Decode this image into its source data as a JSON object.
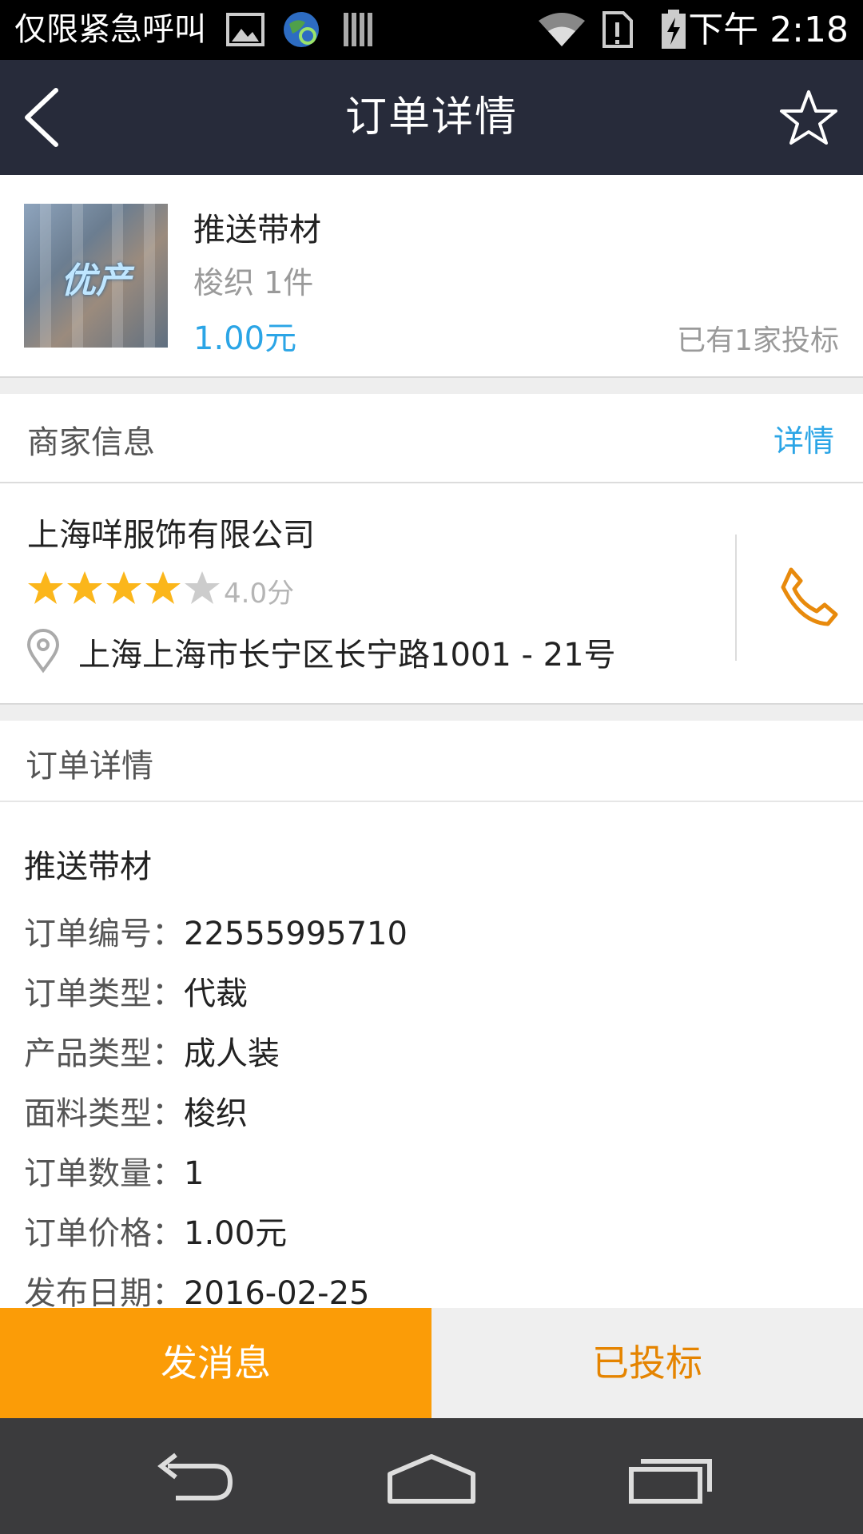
{
  "status_bar": {
    "carrier_text": "仅限紧急呼叫",
    "time": "下午 2:18",
    "icons": [
      "image-icon",
      "globe-sync-icon",
      "barcode-icon",
      "wifi-icon",
      "sim-alert-icon",
      "battery-charging-icon"
    ]
  },
  "header": {
    "title": "订单详情",
    "back_icon": "chevron-left-icon",
    "favorite_icon": "star-outline-icon"
  },
  "product": {
    "thumbnail_text": "优产",
    "name": "推送带材",
    "subtitle": "梭织 1件",
    "price": "1.00元",
    "bids": "已有1家投标"
  },
  "merchant_section": {
    "label": "商家信息",
    "detail_link": "详情"
  },
  "merchant": {
    "name": "上海咩服饰有限公司",
    "stars_filled": 4,
    "stars_total": 5,
    "rating": "4.0分",
    "address": "上海上海市长宁区长宁路1001 - 21号",
    "colors": {
      "star": "#fbb61b",
      "star_empty": "#cccccc",
      "phone": "#e88a0c"
    }
  },
  "order_section": {
    "label": "订单详情",
    "title": "推送带材",
    "rows": [
      {
        "key": "订单编号：",
        "value": "22555995710"
      },
      {
        "key": "订单类型：",
        "value": "代裁"
      },
      {
        "key": "产品类型：",
        "value": "成人装"
      },
      {
        "key": "面料类型：",
        "value": "梭织"
      },
      {
        "key": "订单数量：",
        "value": "1"
      },
      {
        "key": "订单价格：",
        "value": "1.00元"
      },
      {
        "key": "发布日期：",
        "value": "2016-02-25"
      }
    ]
  },
  "actions": {
    "message": "发消息",
    "bid_status": "已投标"
  },
  "system_nav": {
    "icons": [
      "nav-back-icon",
      "nav-home-icon",
      "nav-recents-icon"
    ]
  }
}
